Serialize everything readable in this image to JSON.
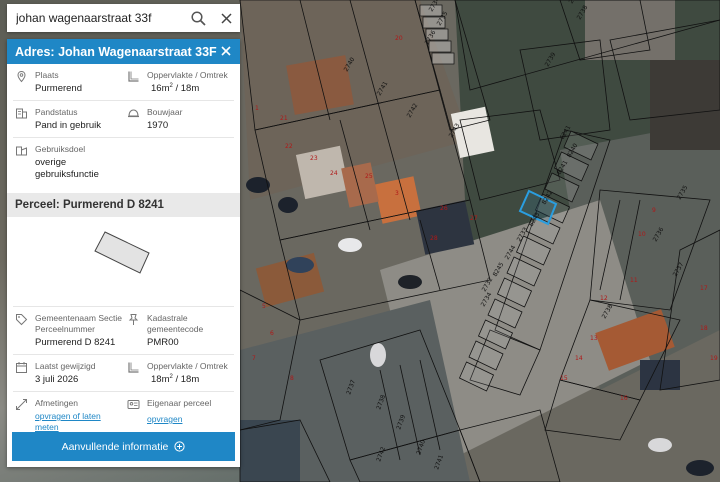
{
  "search": {
    "value": "johan wagenaarstraat 33f"
  },
  "panel": {
    "title": "Adres: Johan Wagenaarstraat 33F",
    "address": {
      "plaats_label": "Plaats",
      "plaats_value": "Purmerend",
      "oppervlakte_label": "Oppervlakte / Omtrek",
      "oppervlakte_area": "16m",
      "oppervlakte_perimeter": "/ 18m",
      "pandstatus_label": "Pandstatus",
      "pandstatus_value": "Pand in gebruik",
      "bouwjaar_label": "Bouwjaar",
      "bouwjaar_value": "1970",
      "gebruiksdoel_label": "Gebruiksdoel",
      "gebruiksdoel_value": "overige gebruiksfunctie"
    },
    "perceel": {
      "title": "Perceel: Purmerend D 8241",
      "gemeente_label": "Gemeentenaam Sectie Perceelnummer",
      "gemeente_value": "Purmerend D 8241",
      "kadastrale_label": "Kadastrale gemeentecode",
      "kadastrale_value": "PMR00",
      "gewijzigd_label": "Laatst gewijzigd",
      "gewijzigd_value": "3 juli 2026",
      "oppervlakte_label": "Oppervlakte / Omtrek",
      "oppervlakte_area": "18m",
      "oppervlakte_perimeter": "/ 18m",
      "afmetingen_label": "Afmetingen",
      "afmetingen_link": "opvragen of laten meten",
      "eigenaar_label": "Eigenaar perceel",
      "eigenaar_link": "opvragen"
    },
    "cta_label": "Aanvullende informatie"
  },
  "map": {
    "labels_black": [
      "2734",
      "2735",
      "2736",
      "2737",
      "2738",
      "2739",
      "2740",
      "2741",
      "2742",
      "2743",
      "6241",
      "8240",
      "8241",
      "8242",
      "8243",
      "2733",
      "2744",
      "8245",
      "2732"
    ],
    "labels_red": [
      "20",
      "1",
      "21",
      "22",
      "23",
      "24",
      "25",
      "3",
      "26",
      "27",
      "28",
      "5",
      "6",
      "7",
      "8",
      "9",
      "10",
      "11",
      "12",
      "13",
      "14",
      "15",
      "16",
      "17",
      "18",
      "19"
    ]
  },
  "colors": {
    "accent": "#1f87c6",
    "section_bg": "#e9e9e9",
    "highlight": "#2a9ee0"
  }
}
